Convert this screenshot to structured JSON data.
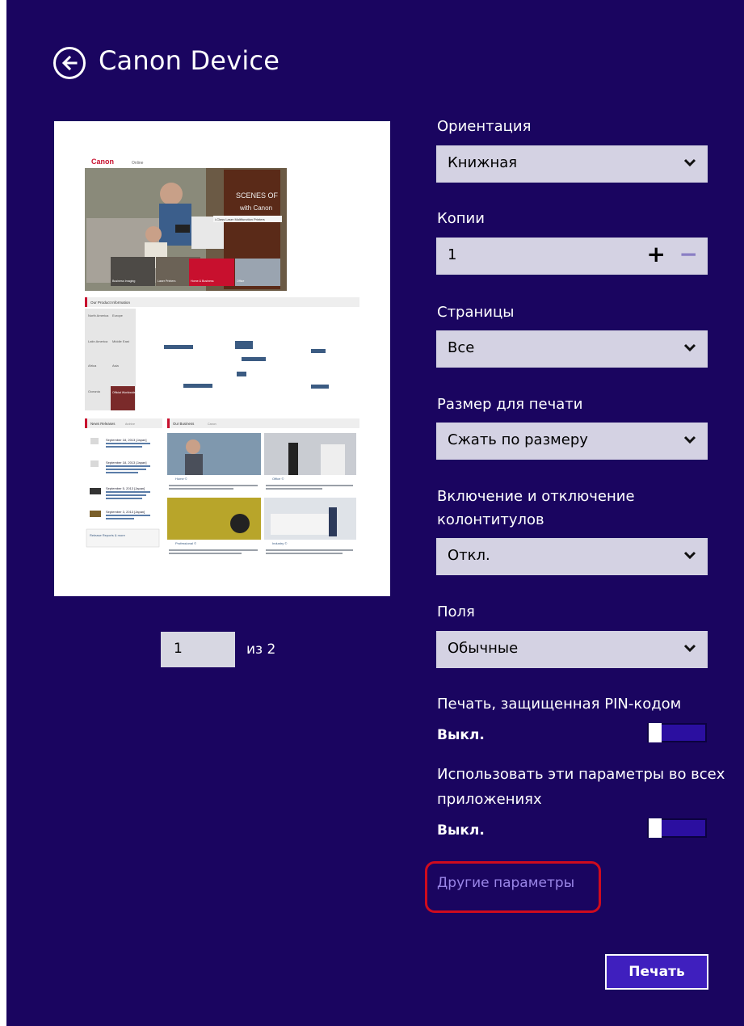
{
  "app": {
    "title": "Canon Device"
  },
  "preview": {
    "current_page": "1",
    "of_label": "из 2",
    "doc": {
      "logo": "Canon",
      "logo_tab": "Online",
      "hero_title": "SCENES OF",
      "hero_sub": "with Canon",
      "hero_bar": "i-Class Laser Multifunction Printers",
      "tabs": [
        "Business Imaging",
        "Laser Printers",
        "Home & Business",
        "Office"
      ],
      "products_heading": "Our Product Information",
      "regions": [
        "North America",
        "Europe",
        "Latin America",
        "Middle East",
        "Africa",
        "Asia",
        "Oceania",
        "Official Worldwide"
      ],
      "news_heading": "News Releases",
      "news_more": "Archive",
      "news": [
        "September 18, 2013 [Japan]",
        "September 18, 2013 [Japan]",
        "September 5, 2013 [Japan]",
        "September 3, 2013 [Japan]"
      ],
      "news_footer": "Release Reports & more",
      "biz_heading": "Our Business",
      "biz_more": "Canon",
      "biz": [
        "Home ©",
        "Office ©",
        "Professional ©",
        "Industry ©"
      ]
    }
  },
  "settings": {
    "orientation": {
      "label": "Ориентация",
      "value": "Книжная"
    },
    "copies": {
      "label": "Копии",
      "value": "1",
      "plus": "+",
      "minus": "−"
    },
    "pages": {
      "label": "Страницы",
      "value": "Все"
    },
    "print_size": {
      "label": "Размер для печати",
      "value": "Сжать по размеру"
    },
    "headers": {
      "label_line1": "Включение и отключение",
      "label_line2": "колонтитулов",
      "value": "Откл."
    },
    "margins": {
      "label": "Поля",
      "value": "Обычные"
    },
    "pin_print": {
      "label": "Печать, защищенная PIN-кодом",
      "state": "Выкл."
    },
    "use_all_apps": {
      "label_line1": "Использовать эти параметры во всех",
      "label_line2": "приложениях",
      "state": "Выкл."
    }
  },
  "more_settings_link": "Другие параметры",
  "print_button": "Печать",
  "colors": {
    "background": "#1a0560",
    "select_bg": "#d4d2e3",
    "highlight": "#d00b1e",
    "link": "#9a86e8",
    "print_btn": "#3f1fbe"
  }
}
